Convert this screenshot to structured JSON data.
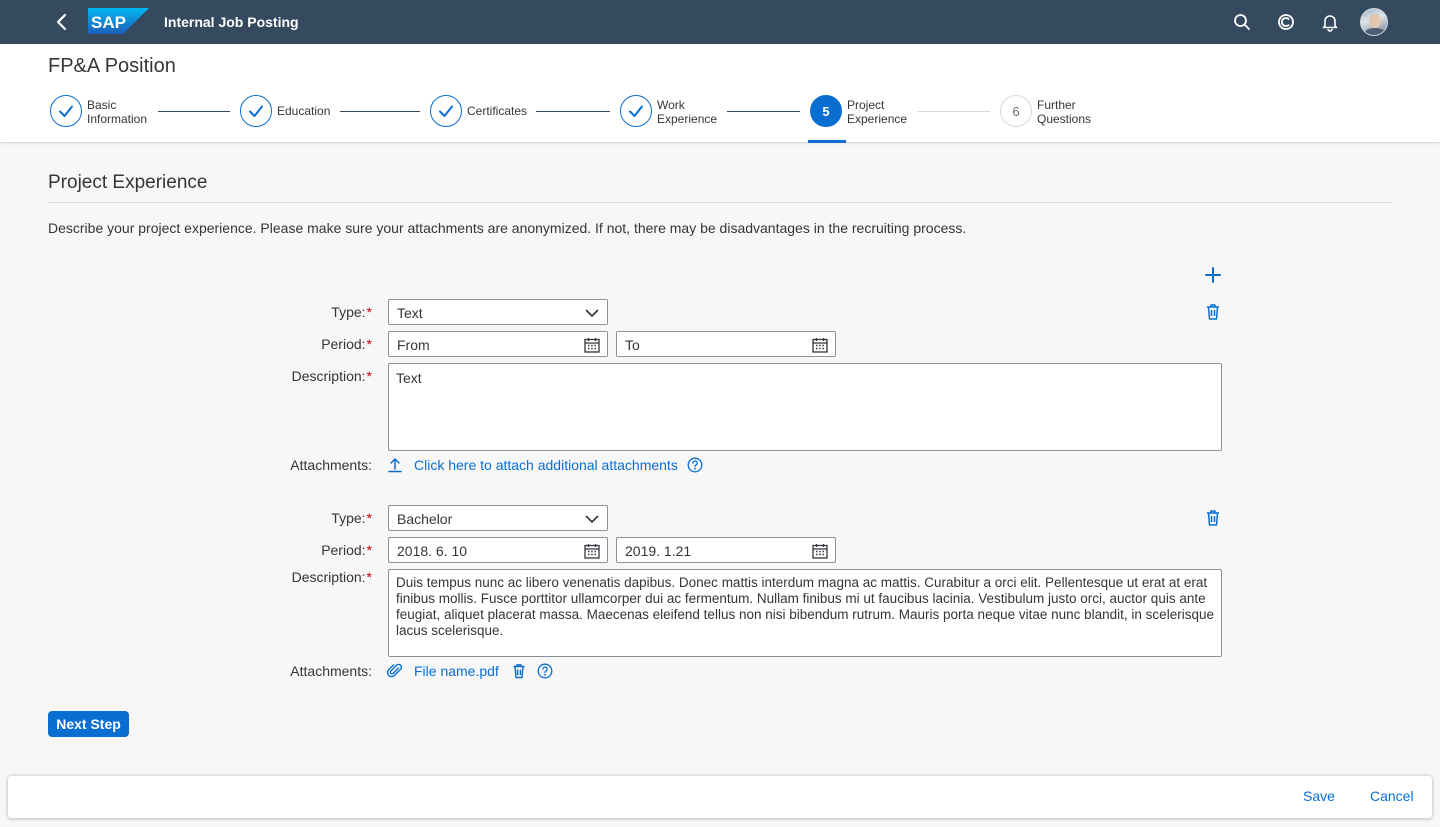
{
  "shell": {
    "app_title": "Internal Job Posting",
    "logo_text": "SAP",
    "icons": [
      "back-icon",
      "search-icon",
      "copilot-icon",
      "bell-icon",
      "avatar"
    ]
  },
  "header": {
    "title": "FP&A Position",
    "steps": [
      {
        "number": "1",
        "label": "Basic Information",
        "status": "completed"
      },
      {
        "number": "2",
        "label": "Education",
        "status": "completed"
      },
      {
        "number": "3",
        "label": "Certificates",
        "status": "completed"
      },
      {
        "number": "4",
        "label": "Work Experience",
        "status": "completed"
      },
      {
        "number": "5",
        "label": "Project Experience",
        "status": "current"
      },
      {
        "number": "6",
        "label": "Further Questions",
        "status": "future"
      }
    ]
  },
  "content": {
    "section_title": "Project Experience",
    "intro": "Describe your project experience. Please make sure your attachments are anonymized. If not, there may be disadvantages in the recruiting process.",
    "labels": {
      "type": "Type:",
      "period": "Period:",
      "description": "Description:",
      "attachments": "Attachments:",
      "required_mark": "*"
    },
    "entries": [
      {
        "type": "Text",
        "from": "From",
        "to": "To",
        "description": "Text",
        "attachment_link": "Click here to attach additional attachments"
      },
      {
        "type": "Bachelor",
        "from": "2018. 6. 10",
        "to": "2019. 1.21",
        "description": "Duis tempus nunc ac libero venenatis dapibus. Donec mattis interdum magna ac mattis. Curabitur a orci elit. Pellentesque ut erat at erat finibus mollis. Fusce porttitor ullamcorper dui ac fermentum. Nullam finibus mi ut faucibus lacinia. Vestibulum justo orci, auctor quis ante feugiat, aliquet placerat massa. Maecenas eleifend tellus non nisi bibendum rutrum. Mauris porta neque vitae nunc blandit, in scelerisque lacus scelerisque.",
        "attachment_file": "File name.pdf"
      }
    ],
    "next_step": "Next Step"
  },
  "footer": {
    "save": "Save",
    "cancel": "Cancel"
  },
  "colors": {
    "shell": "#354a5f",
    "accent": "#0a6ed1",
    "required": "#bb0000"
  }
}
